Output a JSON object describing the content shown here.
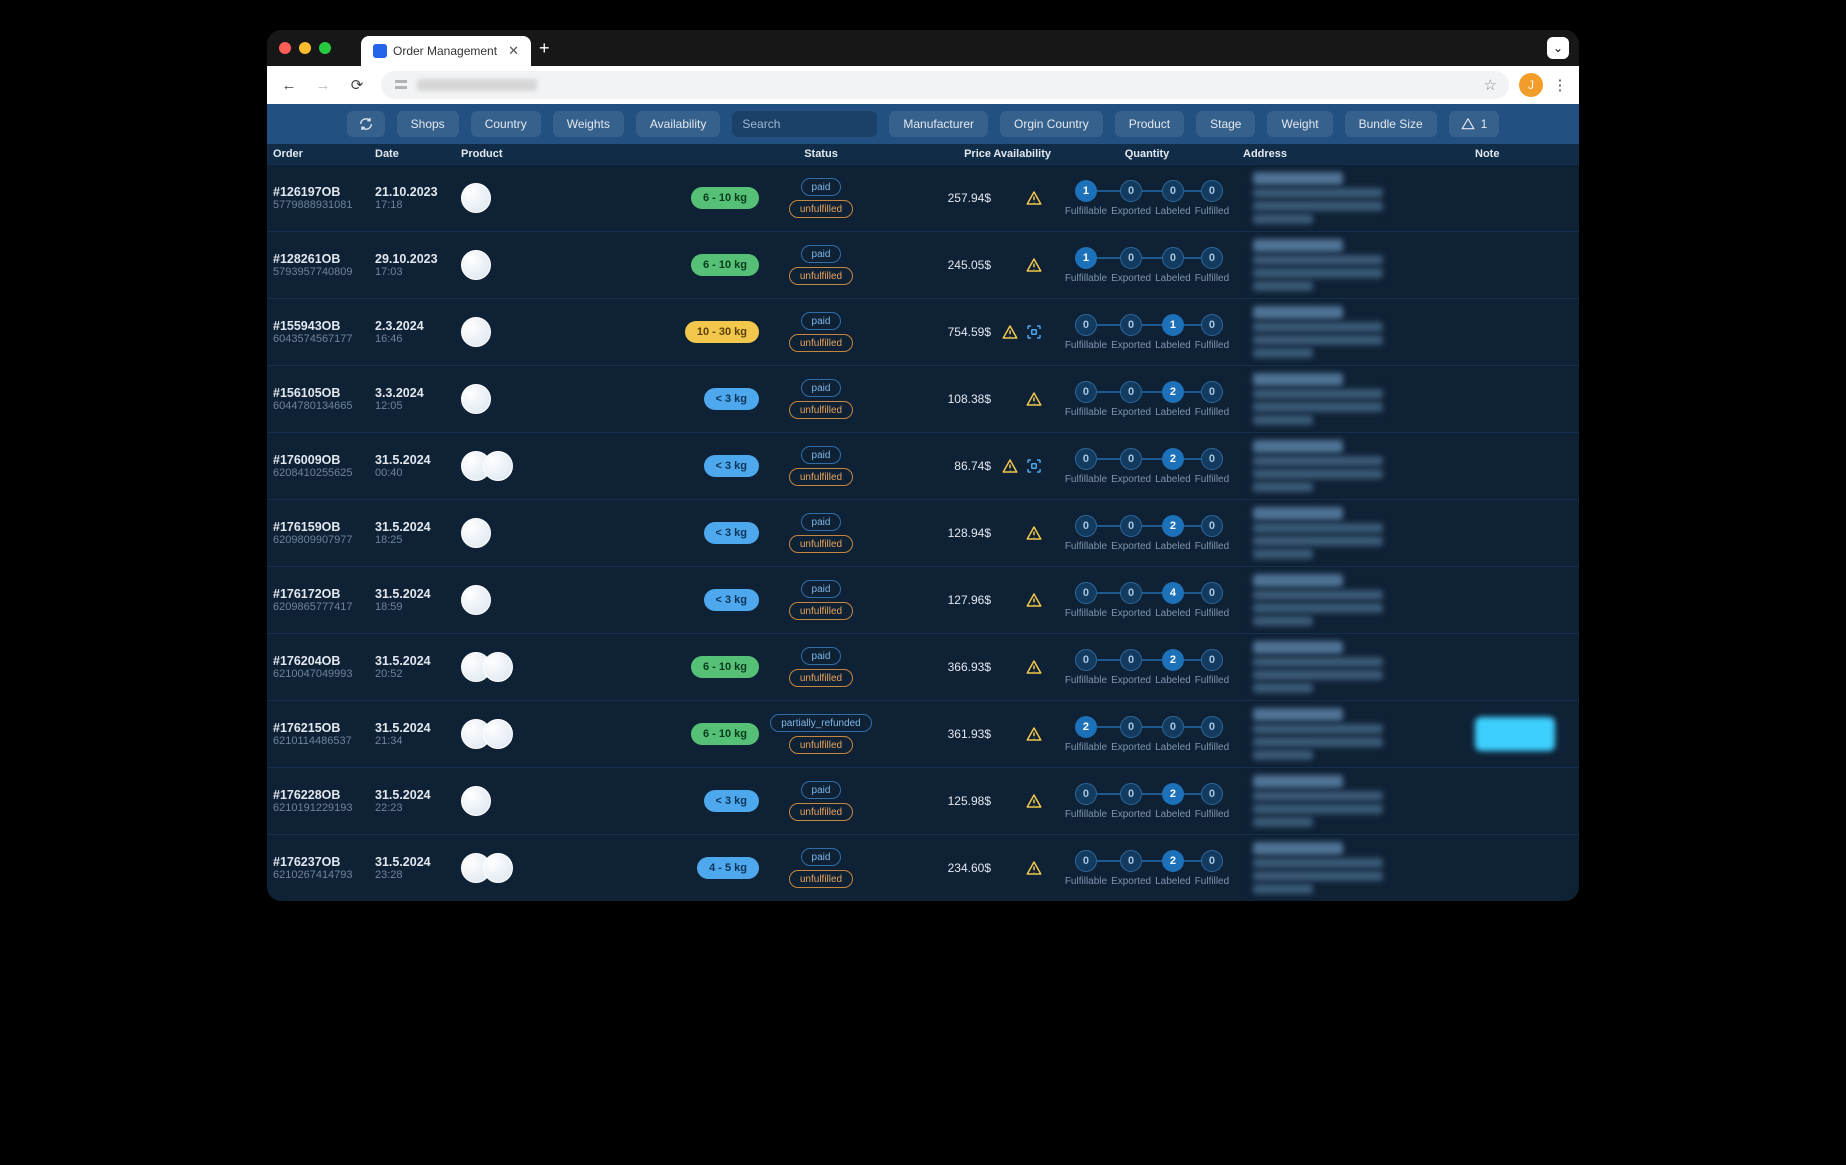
{
  "browser": {
    "tab_title": "Order Management",
    "profile_letter": "J"
  },
  "filters": {
    "shops": "Shops",
    "country": "Country",
    "weights": "Weights",
    "availability": "Availability",
    "search_placeholder": "Search",
    "manufacturer": "Manufacturer",
    "origin_country": "Orgin Country",
    "product": "Product",
    "stage": "Stage",
    "weight": "Weight",
    "bundle_size": "Bundle Size",
    "alert_count": "1"
  },
  "columns": {
    "order": "Order",
    "date": "Date",
    "product": "Product",
    "status": "Status",
    "price": "Price",
    "availability": "Availability",
    "quantity": "Quantity",
    "address": "Address",
    "note": "Note"
  },
  "quantity_labels": {
    "fulfillable": "Fulfillable",
    "exported": "Exported",
    "labeled": "Labeled",
    "fulfilled": "Fulfilled"
  },
  "weight_classes": {
    "g": "6 - 10 kg",
    "y": "10 - 30 kg",
    "b3": "< 3 kg",
    "b45": "4 - 5 kg"
  },
  "rows": [
    {
      "id": "#126197OB",
      "sub": "5779888931081",
      "date": "21.10.2023",
      "time": "17:18",
      "images": 1,
      "weight": "g",
      "status": [
        "paid",
        "unfulfilled"
      ],
      "price": "257.94$",
      "avail": [
        "warn"
      ],
      "qty": [
        1,
        0,
        0,
        0
      ],
      "note": false
    },
    {
      "id": "#128261OB",
      "sub": "5793957740809",
      "date": "29.10.2023",
      "time": "17:03",
      "images": 1,
      "weight": "g",
      "status": [
        "paid",
        "unfulfilled"
      ],
      "price": "245.05$",
      "avail": [
        "warn"
      ],
      "qty": [
        1,
        0,
        0,
        0
      ],
      "note": false
    },
    {
      "id": "#155943OB",
      "sub": "6043574567177",
      "date": "2.3.2024",
      "time": "16:46",
      "images": 1,
      "weight": "y",
      "status": [
        "paid",
        "unfulfilled"
      ],
      "price": "754.59$",
      "avail": [
        "warn",
        "scan"
      ],
      "qty": [
        0,
        0,
        1,
        0
      ],
      "note": false
    },
    {
      "id": "#156105OB",
      "sub": "6044780134665",
      "date": "3.3.2024",
      "time": "12:05",
      "images": 1,
      "weight": "b3",
      "status": [
        "paid",
        "unfulfilled"
      ],
      "price": "108.38$",
      "avail": [
        "warn"
      ],
      "qty": [
        0,
        0,
        2,
        0
      ],
      "note": false
    },
    {
      "id": "#176009OB",
      "sub": "6208410255625",
      "date": "31.5.2024",
      "time": "00:40",
      "images": 2,
      "weight": "b3",
      "status": [
        "paid",
        "unfulfilled"
      ],
      "price": "86.74$",
      "avail": [
        "warn",
        "scan"
      ],
      "qty": [
        0,
        0,
        2,
        0
      ],
      "note": false
    },
    {
      "id": "#176159OB",
      "sub": "6209809907977",
      "date": "31.5.2024",
      "time": "18:25",
      "images": 1,
      "weight": "b3",
      "status": [
        "paid",
        "unfulfilled"
      ],
      "price": "128.94$",
      "avail": [
        "warn"
      ],
      "qty": [
        0,
        0,
        2,
        0
      ],
      "note": false
    },
    {
      "id": "#176172OB",
      "sub": "6209865777417",
      "date": "31.5.2024",
      "time": "18:59",
      "images": 1,
      "weight": "b3",
      "status": [
        "paid",
        "unfulfilled"
      ],
      "price": "127.96$",
      "avail": [
        "warn"
      ],
      "qty": [
        0,
        0,
        4,
        0
      ],
      "note": false
    },
    {
      "id": "#176204OB",
      "sub": "6210047049993",
      "date": "31.5.2024",
      "time": "20:52",
      "images": 2,
      "weight": "g",
      "status": [
        "paid",
        "unfulfilled"
      ],
      "price": "366.93$",
      "avail": [
        "warn"
      ],
      "qty": [
        0,
        0,
        2,
        0
      ],
      "note": false
    },
    {
      "id": "#176215OB",
      "sub": "6210114486537",
      "date": "31.5.2024",
      "time": "21:34",
      "images": 2,
      "weight": "g",
      "status": [
        "partially_refunded",
        "unfulfilled"
      ],
      "price": "361.93$",
      "avail": [
        "warn"
      ],
      "qty": [
        2,
        0,
        0,
        0
      ],
      "note": true
    },
    {
      "id": "#176228OB",
      "sub": "6210191229193",
      "date": "31.5.2024",
      "time": "22:23",
      "images": 1,
      "weight": "b3",
      "status": [
        "paid",
        "unfulfilled"
      ],
      "price": "125.98$",
      "avail": [
        "warn"
      ],
      "qty": [
        0,
        0,
        2,
        0
      ],
      "note": false
    },
    {
      "id": "#176237OB",
      "sub": "6210267414793",
      "date": "31.5.2024",
      "time": "23:28",
      "images": 2,
      "weight": "b45",
      "status": [
        "paid",
        "unfulfilled"
      ],
      "price": "234.60$",
      "avail": [
        "warn"
      ],
      "qty": [
        0,
        0,
        2,
        0
      ],
      "note": false
    }
  ]
}
